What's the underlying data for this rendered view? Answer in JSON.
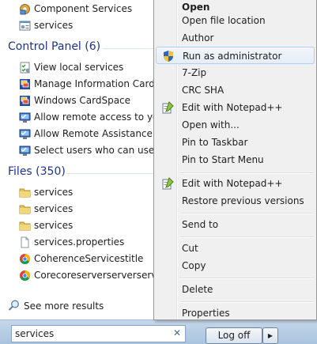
{
  "results": {
    "programs": [
      {
        "label": "Component Services",
        "icon": "component-services-icon"
      },
      {
        "label": "services",
        "icon": "services-icon"
      }
    ],
    "control_panel": {
      "heading": "Control Panel (6)",
      "items": [
        {
          "label": "View local services",
          "icon": "checklist-icon"
        },
        {
          "label": "Manage Information Cards that",
          "icon": "cardspace-icon"
        },
        {
          "label": "Windows CardSpace",
          "icon": "cardspace-icon"
        },
        {
          "label": "Allow remote access to your",
          "icon": "remote-computer-icon"
        },
        {
          "label": "Allow Remote Assistance invi",
          "icon": "remote-computer-icon"
        },
        {
          "label": "Select users who can use rem",
          "icon": "remote-computer-icon"
        }
      ]
    },
    "files": {
      "heading": "Files (350)",
      "items": [
        {
          "label": "services",
          "icon": "folder-icon"
        },
        {
          "label": "services",
          "icon": "folder-icon"
        },
        {
          "label": "services",
          "icon": "folder-icon"
        },
        {
          "label": "services.properties",
          "icon": "file-icon"
        },
        {
          "label": "CoherenceServicestitle",
          "icon": "chrome-icon"
        },
        {
          "label": "Corecoreserverserverservices",
          "icon": "chrome-icon"
        }
      ]
    },
    "see_more": "See more results"
  },
  "search": {
    "value": "services",
    "clear_glyph": "✕"
  },
  "power": {
    "logoff_label": "Log off",
    "arrow_glyph": "▶"
  },
  "context_menu": {
    "items": [
      {
        "label": "Open"
      },
      {
        "label": "Open file location"
      },
      {
        "label": "Author"
      },
      {
        "label": "Run as administrator",
        "icon": "uac-shield-icon",
        "highlighted": true
      },
      {
        "label": "7-Zip"
      },
      {
        "label": "CRC SHA"
      },
      {
        "label": "Edit with Notepad++",
        "icon": "notepad-plus-plus-icon"
      },
      {
        "label": "Open with..."
      },
      {
        "label": "Pin to Taskbar"
      },
      {
        "label": "Pin to Start Menu"
      },
      {
        "label": "Edit with Notepad++",
        "icon": "notepad-plus-plus-icon"
      },
      {
        "label": "Restore previous versions"
      },
      {
        "label": "Send to"
      },
      {
        "label": "Cut"
      },
      {
        "label": "Copy"
      },
      {
        "label": "Delete"
      },
      {
        "label": "Properties"
      }
    ]
  },
  "colors": {
    "group_heading": "#1e3287",
    "highlight_border": "#aecff7",
    "menu_background": "#f0f0f0"
  }
}
